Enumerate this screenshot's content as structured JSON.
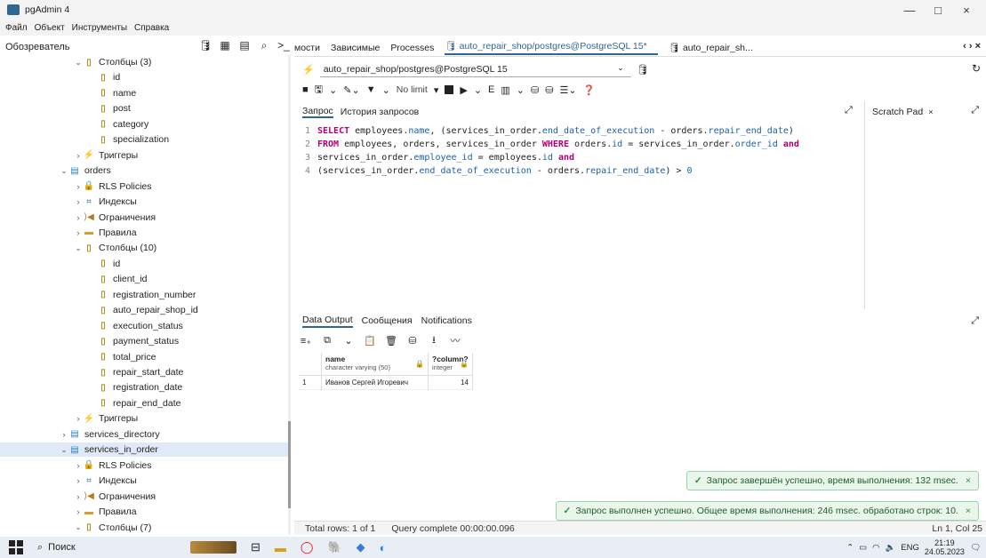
{
  "window": {
    "title": "pgAdmin 4",
    "minimize": "—",
    "maximize": "□",
    "close": "×"
  },
  "menu": [
    "Файл",
    "Объект",
    "Инструменты",
    "Справка"
  ],
  "browser": {
    "title": "Обозреватель",
    "tree": [
      {
        "label": "Столбцы (3)",
        "depth": 3,
        "arrow": "⌄",
        "icon": "column"
      },
      {
        "label": "id",
        "depth": 4,
        "arrow": "",
        "icon": "column"
      },
      {
        "label": "name",
        "depth": 4,
        "arrow": "",
        "icon": "column"
      },
      {
        "label": "post",
        "depth": 4,
        "arrow": "",
        "icon": "column"
      },
      {
        "label": "category",
        "depth": 4,
        "arrow": "",
        "icon": "column"
      },
      {
        "label": "specialization",
        "depth": 4,
        "arrow": "",
        "icon": "column"
      },
      {
        "label": "Триггеры",
        "depth": 3,
        "arrow": "›",
        "icon": "trigger"
      },
      {
        "label": "orders",
        "depth": 2,
        "arrow": "⌄",
        "icon": "table"
      },
      {
        "label": "RLS Policies",
        "depth": 3,
        "arrow": "›",
        "icon": "lock"
      },
      {
        "label": "Индексы",
        "depth": 3,
        "arrow": "›",
        "icon": "index"
      },
      {
        "label": "Ограничения",
        "depth": 3,
        "arrow": "›",
        "icon": "constraint"
      },
      {
        "label": "Правила",
        "depth": 3,
        "arrow": "›",
        "icon": "rule"
      },
      {
        "label": "Столбцы (10)",
        "depth": 3,
        "arrow": "⌄",
        "icon": "column"
      },
      {
        "label": "id",
        "depth": 4,
        "arrow": "",
        "icon": "column"
      },
      {
        "label": "client_id",
        "depth": 4,
        "arrow": "",
        "icon": "column"
      },
      {
        "label": "registration_number",
        "depth": 4,
        "arrow": "",
        "icon": "column"
      },
      {
        "label": "auto_repair_shop_id",
        "depth": 4,
        "arrow": "",
        "icon": "column"
      },
      {
        "label": "execution_status",
        "depth": 4,
        "arrow": "",
        "icon": "column"
      },
      {
        "label": "payment_status",
        "depth": 4,
        "arrow": "",
        "icon": "column"
      },
      {
        "label": "total_price",
        "depth": 4,
        "arrow": "",
        "icon": "column"
      },
      {
        "label": "repair_start_date",
        "depth": 4,
        "arrow": "",
        "icon": "column"
      },
      {
        "label": "registration_date",
        "depth": 4,
        "arrow": "",
        "icon": "column"
      },
      {
        "label": "repair_end_date",
        "depth": 4,
        "arrow": "",
        "icon": "column"
      },
      {
        "label": "Триггеры",
        "depth": 3,
        "arrow": "›",
        "icon": "trigger"
      },
      {
        "label": "services_directory",
        "depth": 2,
        "arrow": "›",
        "icon": "table"
      },
      {
        "label": "services_in_order",
        "depth": 2,
        "arrow": "⌄",
        "icon": "table",
        "selected": true
      },
      {
        "label": "RLS Policies",
        "depth": 3,
        "arrow": "›",
        "icon": "lock"
      },
      {
        "label": "Индексы",
        "depth": 3,
        "arrow": "›",
        "icon": "index"
      },
      {
        "label": "Ограничения",
        "depth": 3,
        "arrow": "›",
        "icon": "constraint"
      },
      {
        "label": "Правила",
        "depth": 3,
        "arrow": "›",
        "icon": "rule"
      },
      {
        "label": "Столбцы (7)",
        "depth": 3,
        "arrow": "⌄",
        "icon": "column"
      }
    ]
  },
  "tabs": [
    "мости",
    "Зависимые",
    "Processes",
    "auto_repair_shop/postgres@PostgreSQL 15*",
    "auto_repair_sh..."
  ],
  "connection": "auto_repair_shop/postgres@PostgreSQL 15",
  "toolbar": {
    "limit": "No limit"
  },
  "query_tabs": [
    "Запрос",
    "История запросов"
  ],
  "scratch_pad": "Scratch Pad",
  "sql_lines": [
    {
      "n": "1",
      "parts": [
        [
          "kw",
          "SELECT"
        ],
        [
          "t",
          " employees."
        ],
        [
          "fld",
          "name"
        ],
        [
          "t",
          ", (services_in_order."
        ],
        [
          "fld",
          "end_date_of_execution"
        ],
        [
          "t",
          " - orders."
        ],
        [
          "fld",
          "repair_end_date"
        ],
        [
          "t",
          ")"
        ]
      ]
    },
    {
      "n": "2",
      "parts": [
        [
          "kw",
          "FROM"
        ],
        [
          "t",
          " employees, orders, services_in_order "
        ],
        [
          "kw",
          "WHERE"
        ],
        [
          "t",
          " orders."
        ],
        [
          "fld",
          "id"
        ],
        [
          "t",
          " = services_in_order."
        ],
        [
          "fld",
          "order_id"
        ],
        [
          "t",
          " "
        ],
        [
          "kw",
          "and"
        ]
      ]
    },
    {
      "n": "3",
      "parts": [
        [
          "t",
          "services_in_order."
        ],
        [
          "fld",
          "employee_id"
        ],
        [
          "t",
          " = employees."
        ],
        [
          "fld",
          "id"
        ],
        [
          "t",
          " "
        ],
        [
          "kw",
          "and"
        ]
      ]
    },
    {
      "n": "4",
      "parts": [
        [
          "t",
          "(services_in_order."
        ],
        [
          "fld",
          "end_date_of_execution"
        ],
        [
          "t",
          " - orders."
        ],
        [
          "fld",
          "repair_end_date"
        ],
        [
          "t",
          ") > "
        ],
        [
          "num",
          "0"
        ]
      ]
    }
  ],
  "result_tabs": [
    "Data Output",
    "Сообщения",
    "Notifications"
  ],
  "grid": {
    "columns": [
      {
        "name": "name",
        "type": "character varying (50)"
      },
      {
        "name": "?column?",
        "type": "integer"
      }
    ],
    "rows": [
      {
        "n": "1",
        "name": "Иванов Сергей Игоревич",
        "value": "14"
      }
    ]
  },
  "toasts": [
    "Запрос завершён успешно, время выполнения: 132 msec.",
    "Запрос выполнен успешно. Общее время выполнения: 246 msec. обработано строк: 10."
  ],
  "status": {
    "rows": "Total rows: 1 of 1",
    "query": "Query complete 00:00:00.096",
    "pos": "Ln 1, Col 25"
  },
  "taskbar": {
    "search": "Поиск",
    "lang": "ENG",
    "time": "21:19",
    "date": "24.05.2023"
  }
}
